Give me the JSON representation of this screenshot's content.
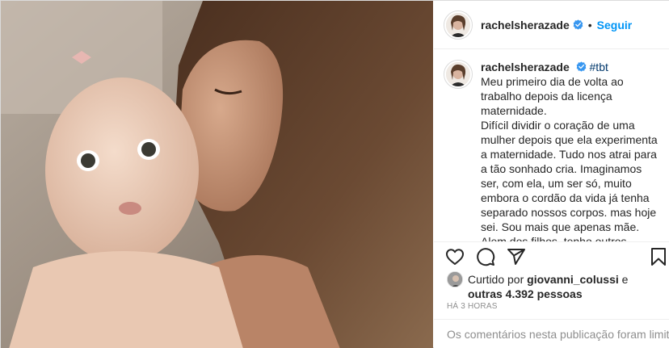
{
  "post": {
    "username": "rachelsherazade",
    "follow_label": "Seguir",
    "separator": "•",
    "hashtag": "#tbt",
    "caption": "Meu primeiro dia de volta ao trabalho depois da licença maternidade.\nDifícil dividir o coração de uma mulher depois que ela experimenta a maternidade. Tudo nos atrai para a tão sonhado cria. Imaginamos ser, com ela, um ser só, muito embora o cordão da vida já tenha separado nossos corpos. mas hoje sei. Sou mais que apenas mãe. Alem dos filhos, tenho outros amores, e desejos, e sonhos. Por isso, apesar da dor da",
    "likes": {
      "prefix": "Curtido por",
      "liker": "giovanni_colussi",
      "connector": "e",
      "others": "outras 4.392 pessoas"
    },
    "timestamp": "HÁ 3 HORAS",
    "comments_limited": "Os comentários nesta publicação foram limitados."
  },
  "icons": {
    "like": "heart-icon",
    "comment": "comment-icon",
    "share": "share-icon",
    "save": "bookmark-icon",
    "verified": "verified-badge-icon"
  },
  "colors": {
    "link": "#0095f6",
    "verified": "#3897f0",
    "muted": "#8e8e8e",
    "text": "#262626"
  }
}
